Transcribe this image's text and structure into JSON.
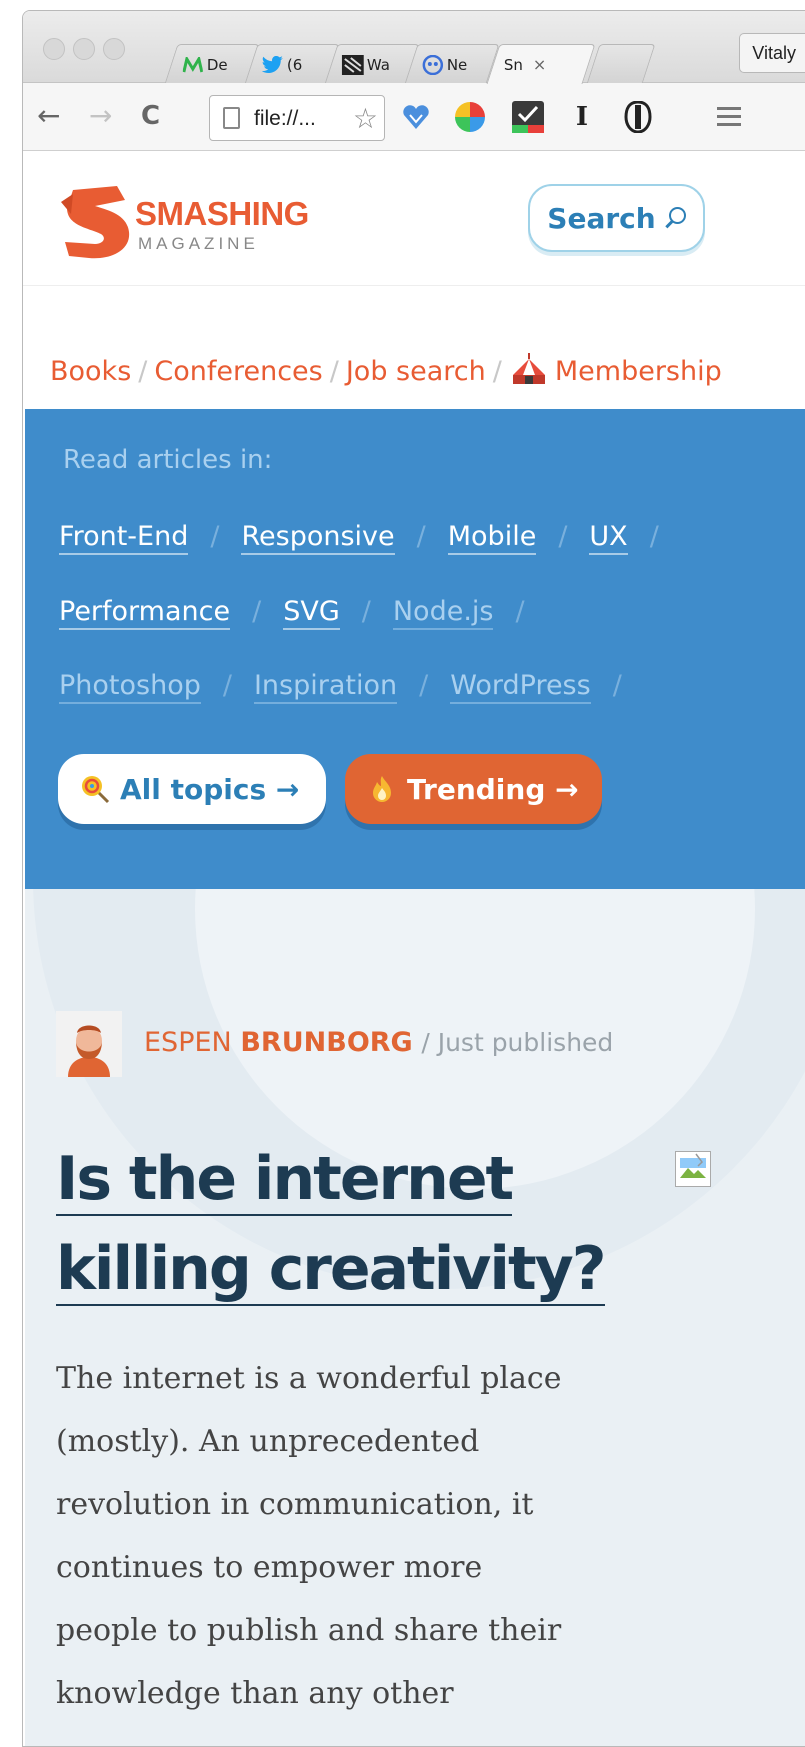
{
  "browser": {
    "tabs": [
      {
        "label": "De",
        "icon": "medium-icon",
        "color": "#2fb34b"
      },
      {
        "label": "(6",
        "icon": "twitter-icon",
        "color": "#1da1f2"
      },
      {
        "label": "Wa",
        "icon": "windows-icon",
        "color": "#222222"
      },
      {
        "label": "Ne",
        "icon": "ghost-icon",
        "color": "#3b6fd8"
      },
      {
        "label": "Sn",
        "icon": "",
        "active": true,
        "close": "×"
      },
      {
        "label": "",
        "icon": ""
      }
    ],
    "profile_name": "Vitaly",
    "url": "file://...",
    "nav": {
      "back": "←",
      "forward": "→",
      "reload": "C"
    },
    "ext_text_icon": "I"
  },
  "site": {
    "logo_word": "SMASHING",
    "logo_sub": "MAGAZINE",
    "search_label": "Search",
    "nav_links": [
      "Books",
      "Conferences",
      "Job search",
      "Membership"
    ],
    "nav_sep": "/",
    "topics_intro": "Read articles in:",
    "topics_rows": [
      [
        "Front-End",
        "Responsive",
        "Mobile",
        "UX"
      ],
      [
        "Performance",
        "SVG",
        "Node.js"
      ],
      [
        "Photoshop",
        "Inspiration",
        "WordPress"
      ]
    ],
    "all_topics_label": "All topics →",
    "trending_label": "Trending →",
    "accent": "#e85c33",
    "blue": "#3f8ccb"
  },
  "article": {
    "author_first": "ESPEN",
    "author_last": "BRUNBORG",
    "meta": "/ Just published",
    "headline_line1": "Is the internet",
    "headline_line2": "killing creativity?",
    "excerpt_lines": [
      "The internet is a wonderful place",
      "(mostly). An unprecedented",
      "revolution in communication, it",
      "continues to empower more",
      "people to publish and share their",
      "knowledge than any other"
    ]
  }
}
